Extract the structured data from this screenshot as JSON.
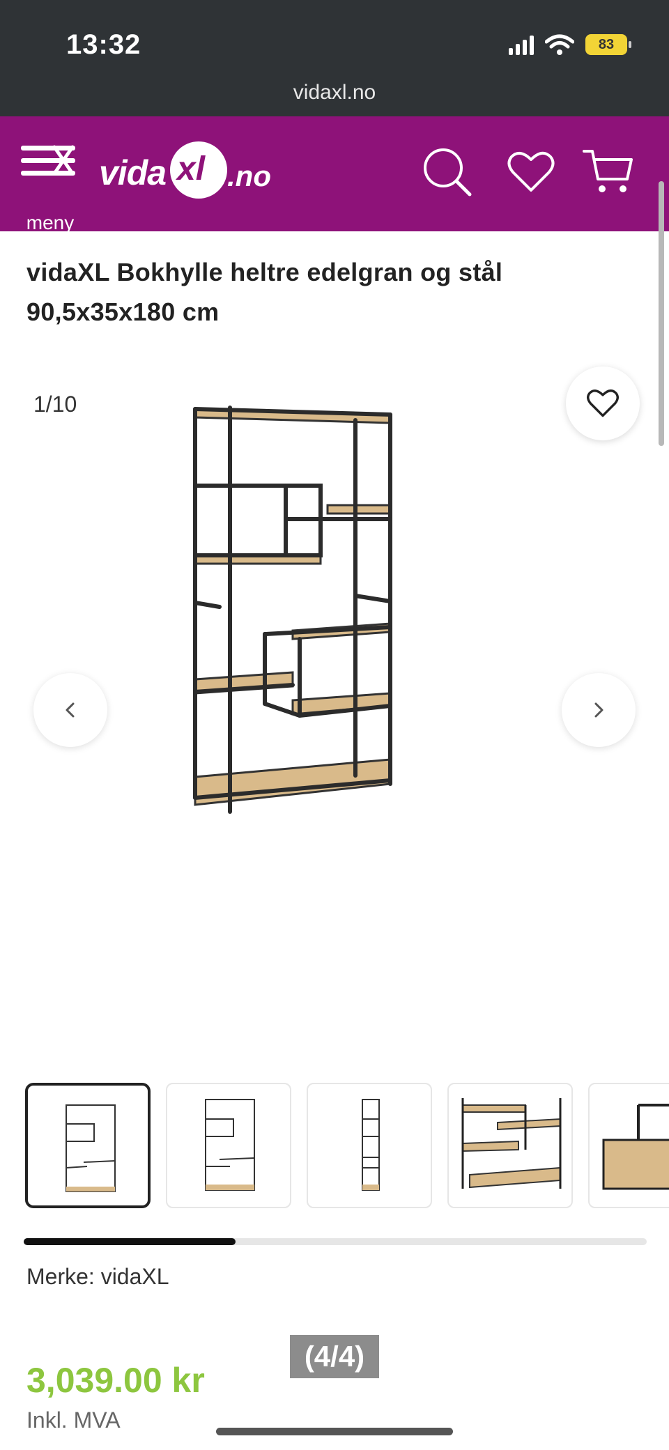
{
  "status_bar": {
    "time": "13:32",
    "battery": "83",
    "url": "vidaxl.no"
  },
  "header": {
    "menu_label": "meny",
    "logo_vida": "vida",
    "logo_xl": "xl",
    "logo_tld": ".no",
    "background_color": "#8e1279",
    "icons": [
      "menu-icon",
      "search-icon",
      "heart-icon",
      "cart-icon"
    ]
  },
  "product": {
    "title": "vidaXL Bokhylle heltre edelgran og stål 90,5x35x180 cm",
    "image_counter": "1/10",
    "brand_label": "Merke: vidaXL",
    "price": "3,039.00 kr",
    "vat_note": "Inkl. MVA",
    "price_color": "#8dc63f"
  },
  "gallery": {
    "thumbnails": [
      "front-view",
      "front-view-alt",
      "side-view",
      "detail-view",
      "corner-detail"
    ],
    "active_index": 0,
    "scroll_fraction": 0.34
  },
  "overlay": {
    "page_indicator": "(4/4)"
  }
}
